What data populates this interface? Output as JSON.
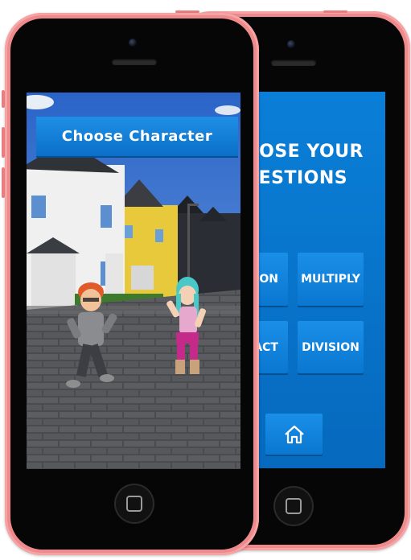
{
  "front_screen": {
    "banner_label": "Choose Character"
  },
  "back_screen": {
    "title_line1": "HOOSE YOUR",
    "title_line2": "QUESTIONS",
    "buttons": {
      "addition_partial": "ION",
      "multiply": "MULTIPLY",
      "subtract_partial": "RACT",
      "division": "DIVISION"
    },
    "home_icon": "home-icon"
  },
  "colors": {
    "phone_body": "#ee8a8c",
    "menu_blue": "#0a77d0",
    "screen_bg_blue": "#0669bd"
  }
}
